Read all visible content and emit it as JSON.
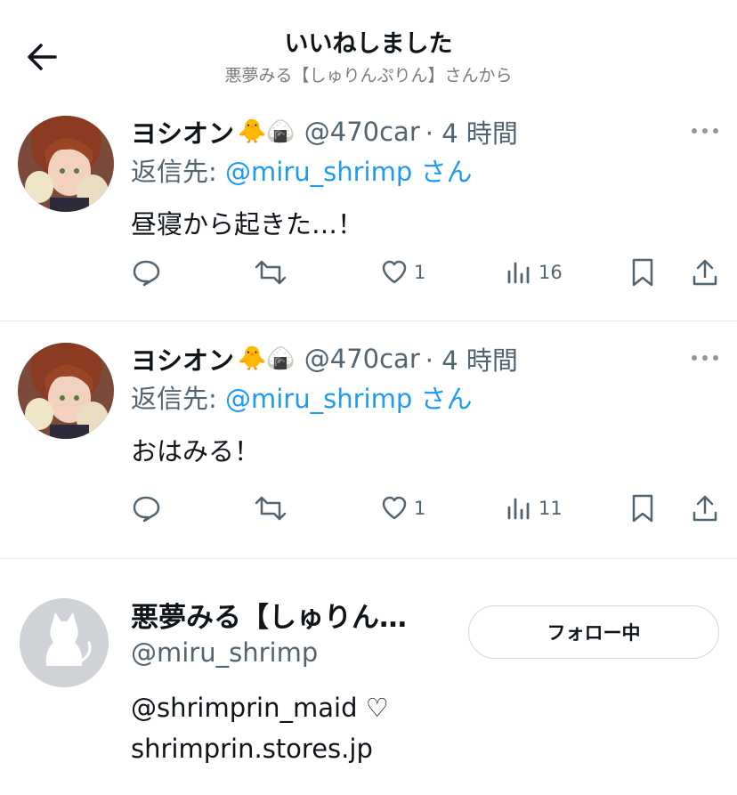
{
  "header": {
    "title": "いいねしました",
    "subtitle": "悪夢みる【しゅりんぷりん】さんから"
  },
  "tweets": [
    {
      "author_name": "ヨシオン",
      "author_emoji": "🐥🍙",
      "handle": "@470car",
      "time": "· 4 時間",
      "reply_prefix": "返信先: ",
      "reply_to": "@miru_shrimp",
      "reply_suffix": " さん",
      "text": "昼寝から起きた…！",
      "stats": {
        "likes": "1",
        "views": "16"
      }
    },
    {
      "author_name": "ヨシオン",
      "author_emoji": "🐥🍙",
      "handle": "@470car",
      "time": "· 4 時間",
      "reply_prefix": "返信先: ",
      "reply_to": "@miru_shrimp",
      "reply_suffix": " さん",
      "text": "おはみる！",
      "stats": {
        "likes": "1",
        "views": "11"
      }
    }
  ],
  "user": {
    "name": "悪夢みる【しゅりん…",
    "handle": "@miru_shrimp",
    "follow_label": "フォロー中",
    "bio_lines": [
      "@shrimprin_maid ♡",
      "shrimprin.stores.jp"
    ]
  },
  "icons": [
    "back-arrow-icon",
    "more-icon",
    "reply-icon",
    "retweet-icon",
    "heart-icon",
    "views-icon",
    "bookmark-icon",
    "share-icon",
    "default-avatar-icon"
  ],
  "colors": {
    "link": "#1d9bf0",
    "secondary": "#536471",
    "divider": "#e5e7ea"
  }
}
